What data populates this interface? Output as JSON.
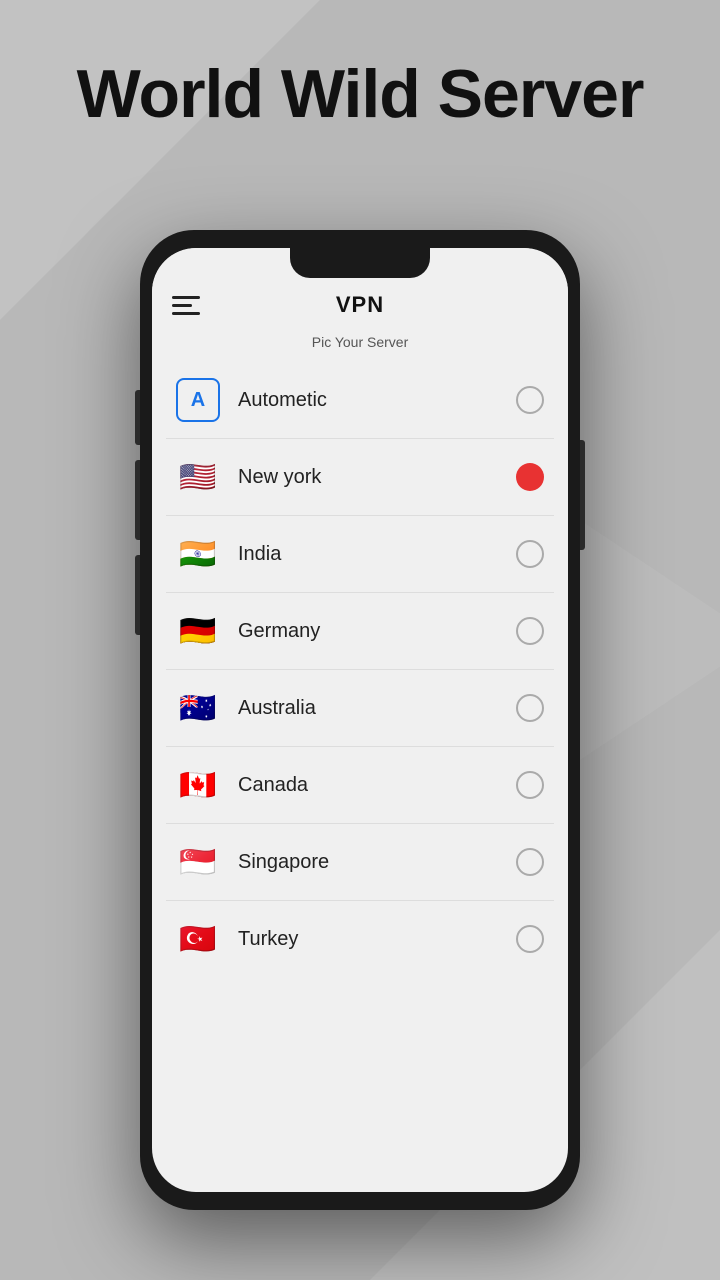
{
  "page": {
    "title": "World Wild Server",
    "background_color": "#b8b8b8"
  },
  "app": {
    "title": "VPN",
    "subtitle": "Pic Your Server",
    "menu_icon": "hamburger-icon"
  },
  "servers": [
    {
      "id": "automatic",
      "name": "Autometic",
      "icon_type": "auto",
      "selected": false
    },
    {
      "id": "new-york",
      "name": "New york",
      "icon_type": "flag",
      "flag_emoji": "🇺🇸",
      "selected": true
    },
    {
      "id": "india",
      "name": "India",
      "icon_type": "flag",
      "flag_emoji": "🇮🇳",
      "selected": false
    },
    {
      "id": "germany",
      "name": "Germany",
      "icon_type": "flag",
      "flag_emoji": "🇩🇪",
      "selected": false
    },
    {
      "id": "australia",
      "name": "Australia",
      "icon_type": "flag",
      "flag_emoji": "🇦🇺",
      "selected": false
    },
    {
      "id": "canada",
      "name": "Canada",
      "icon_type": "flag",
      "flag_emoji": "🇨🇦",
      "selected": false
    },
    {
      "id": "singapore",
      "name": "Singapore",
      "icon_type": "flag",
      "flag_emoji": "🇸🇬",
      "selected": false
    },
    {
      "id": "turkey",
      "name": "Turkey",
      "icon_type": "flag",
      "flag_emoji": "🇹🇷",
      "selected": false
    }
  ],
  "colors": {
    "selected_radio": "#e83232",
    "unselected_radio_border": "#aaa",
    "accent_blue": "#1a73e8"
  }
}
